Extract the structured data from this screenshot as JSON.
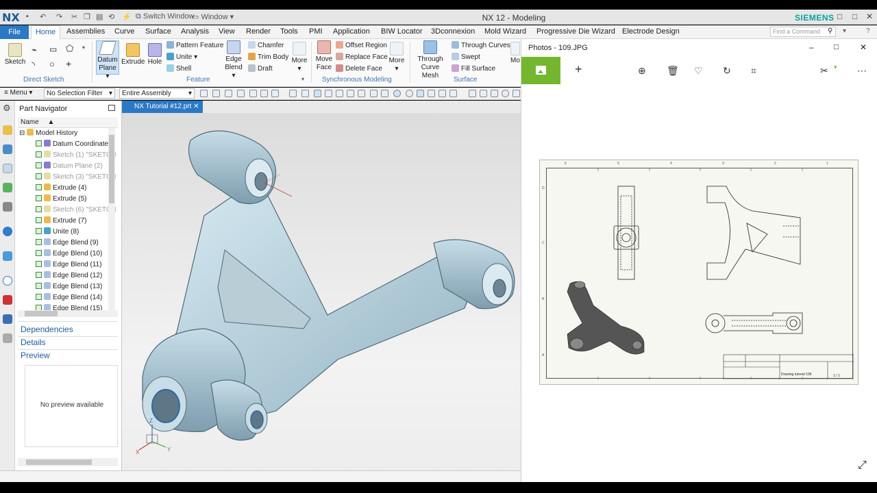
{
  "window": {
    "app_logo": "NX",
    "title": "NX 12 - Modeling",
    "brand": "SIEMENS",
    "switch_window": "Switch Window",
    "window_menu": "Window",
    "min": "–",
    "max": "□",
    "close": "✕"
  },
  "menu": {
    "file": "File",
    "tabs": [
      "Home",
      "Assemblies",
      "Curve",
      "Surface",
      "Analysis",
      "View",
      "Render",
      "Tools",
      "PMI",
      "Application",
      "BIW Locator",
      "3Dconnexion",
      "Mold Wizard",
      "Progressive Die Wizard",
      "Electrode Design"
    ],
    "find_placeholder": "Find a Command"
  },
  "ribbon": {
    "sketch": "Sketch",
    "direct_sketch": "Direct Sketch",
    "datum_plane": [
      "Datum",
      "Plane"
    ],
    "extrude": "Extrude",
    "hole": "Hole",
    "pattern_feature": "Pattern Feature",
    "unite": "Unite",
    "shell": "Shell",
    "edge_blend": [
      "Edge",
      "Blend"
    ],
    "chamfer": "Chamfer",
    "trim_body": "Trim Body",
    "draft": "Draft",
    "more": "More",
    "feature": "Feature",
    "move_face": [
      "Move",
      "Face"
    ],
    "offset_region": "Offset Region",
    "replace_face": "Replace Face",
    "delete_face": "Delete Face",
    "synchronous_modeling": "Synchronous Modeling",
    "through_curve_mesh": [
      "Through",
      "Curve Mesh"
    ],
    "through_curves": "Through Curves",
    "swept": "Swept",
    "fill_surface": "Fill Surface",
    "surface": "Surface",
    "more_trunc": "Mo"
  },
  "selbar": {
    "menu": "Menu",
    "filter": "No Selection Filter",
    "scope": "Entire Assembly"
  },
  "navigator": {
    "title": "Part Navigator",
    "col_name": "Name",
    "root": "Model History",
    "items": [
      {
        "label": "Datum Coordinate",
        "dim": false
      },
      {
        "label": "Sketch (1) \"SKETCH",
        "dim": true
      },
      {
        "label": "Datum Plane (2)",
        "dim": true
      },
      {
        "label": "Sketch (3) \"SKETCH",
        "dim": true
      },
      {
        "label": "Extrude (4)",
        "dim": false
      },
      {
        "label": "Extrude (5)",
        "dim": false
      },
      {
        "label": "Sketch (6) \"SKETCH",
        "dim": true
      },
      {
        "label": "Extrude (7)",
        "dim": false
      },
      {
        "label": "Unite (8)",
        "dim": false
      },
      {
        "label": "Edge Blend (9)",
        "dim": false
      },
      {
        "label": "Edge Blend (10)",
        "dim": false
      },
      {
        "label": "Edge Blend (11)",
        "dim": false
      },
      {
        "label": "Edge Blend (12)",
        "dim": false
      },
      {
        "label": "Edge Blend (13)",
        "dim": false
      },
      {
        "label": "Edge Blend (14)",
        "dim": false
      },
      {
        "label": "Edge Blend (15)",
        "dim": false
      }
    ],
    "dependencies": "Dependencies",
    "details": "Details",
    "preview": "Preview",
    "no_preview": "No preview available"
  },
  "viewport": {
    "doc_tab": "NX Tutorial #12.prt",
    "tab_close": "✕",
    "triad": {
      "x": "X",
      "y": "Y",
      "z": "Z"
    }
  },
  "photos": {
    "title": "Photos - 109.JPG",
    "min": "–",
    "max": "□",
    "close": "✕",
    "drawing": {
      "cols": [
        "6",
        "5",
        "4",
        "3",
        "2",
        "1"
      ],
      "rows": [
        "D",
        "C",
        "B",
        "A"
      ],
      "title_block": "Drawing tutorial 109",
      "sheet": "1 / 1"
    }
  },
  "colors": {
    "accent": "#2b78c5",
    "photos_accent": "#74b72e",
    "part": "#b8d3df"
  }
}
